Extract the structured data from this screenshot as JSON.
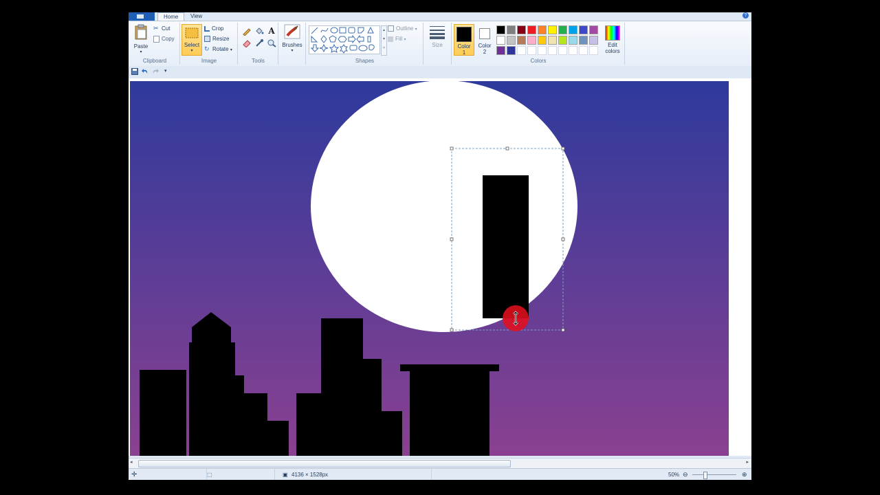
{
  "tabs": {
    "home": "Home",
    "view": "View"
  },
  "ribbon": {
    "clipboard": {
      "paste": "Paste",
      "cut": "Cut",
      "copy": "Copy",
      "label": "Clipboard"
    },
    "image": {
      "select": "Select",
      "crop": "Crop",
      "resize": "Resize",
      "rotate": "Rotate",
      "label": "Image"
    },
    "tools": {
      "text_tool": "A",
      "label": "Tools"
    },
    "brushes": {
      "label": "Brushes"
    },
    "shapes": {
      "outline": "Outline",
      "fill": "Fill",
      "label": "Shapes"
    },
    "size": {
      "label": "Size"
    },
    "colors": {
      "color1": "Color\n1",
      "color2": "Color\n2",
      "edit": "Edit\ncolors",
      "label": "Colors",
      "color1_value": "#000000",
      "color2_value": "#ffffff",
      "palette": [
        "#000000",
        "#7f7f7f",
        "#880015",
        "#ed1c24",
        "#ff7f27",
        "#fff200",
        "#22b14c",
        "#00a2e8",
        "#3f48cc",
        "#a349a4",
        "#ffffff",
        "#c3c3c3",
        "#b97a57",
        "#ffaec9",
        "#ffc90e",
        "#efe4b0",
        "#b5e61d",
        "#99d9ea",
        "#7092be",
        "#c8bfe7",
        "#6f3198",
        "#2f3699",
        "#ffffff",
        "#ffffff",
        "#ffffff",
        "#ffffff",
        "#ffffff",
        "#ffffff",
        "#ffffff",
        "#ffffff"
      ]
    }
  },
  "canvas": {
    "sky_top": "#2e3a9c",
    "sky_bottom": "#8a4090",
    "moon": "#ffffff",
    "silhouette": "#000000",
    "cursor_marker": "#e0101e"
  },
  "status": {
    "dimensions": "4136 × 1528px",
    "zoom": "50%"
  }
}
